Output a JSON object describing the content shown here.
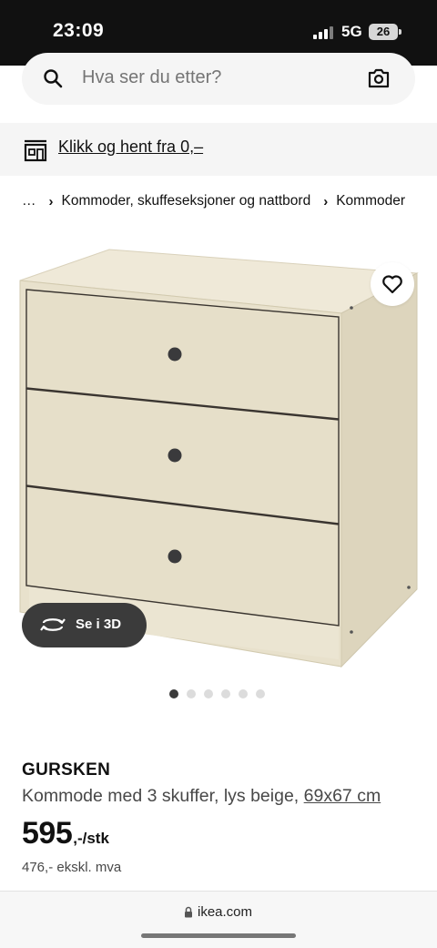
{
  "status_bar": {
    "time": "23:09",
    "network": "5G",
    "battery": "26"
  },
  "search": {
    "placeholder": "Hva ser du etter?"
  },
  "pickup": {
    "label": "Klikk og hent fra 0,–"
  },
  "breadcrumb": {
    "items": [
      "…",
      "Kommoder, skuffeseksjoner og nattbord",
      "Kommoder"
    ]
  },
  "gallery": {
    "view3d_label": "Se i 3D",
    "image_count": 6,
    "active_index": 0
  },
  "product": {
    "name": "GURSKEN",
    "description": "Kommode med 3 skuffer, lys beige, ",
    "size": "69x67 cm",
    "price": "595",
    "price_suffix": ",-/stk",
    "price_ex_vat": "476,- ekskl. mva"
  },
  "browser": {
    "url": "ikea.com"
  },
  "colors": {
    "status_bar": "#111111",
    "furniture": "#e8e1cc",
    "knob": "#3a3a3c",
    "button_dark": "#3b3b3b"
  }
}
